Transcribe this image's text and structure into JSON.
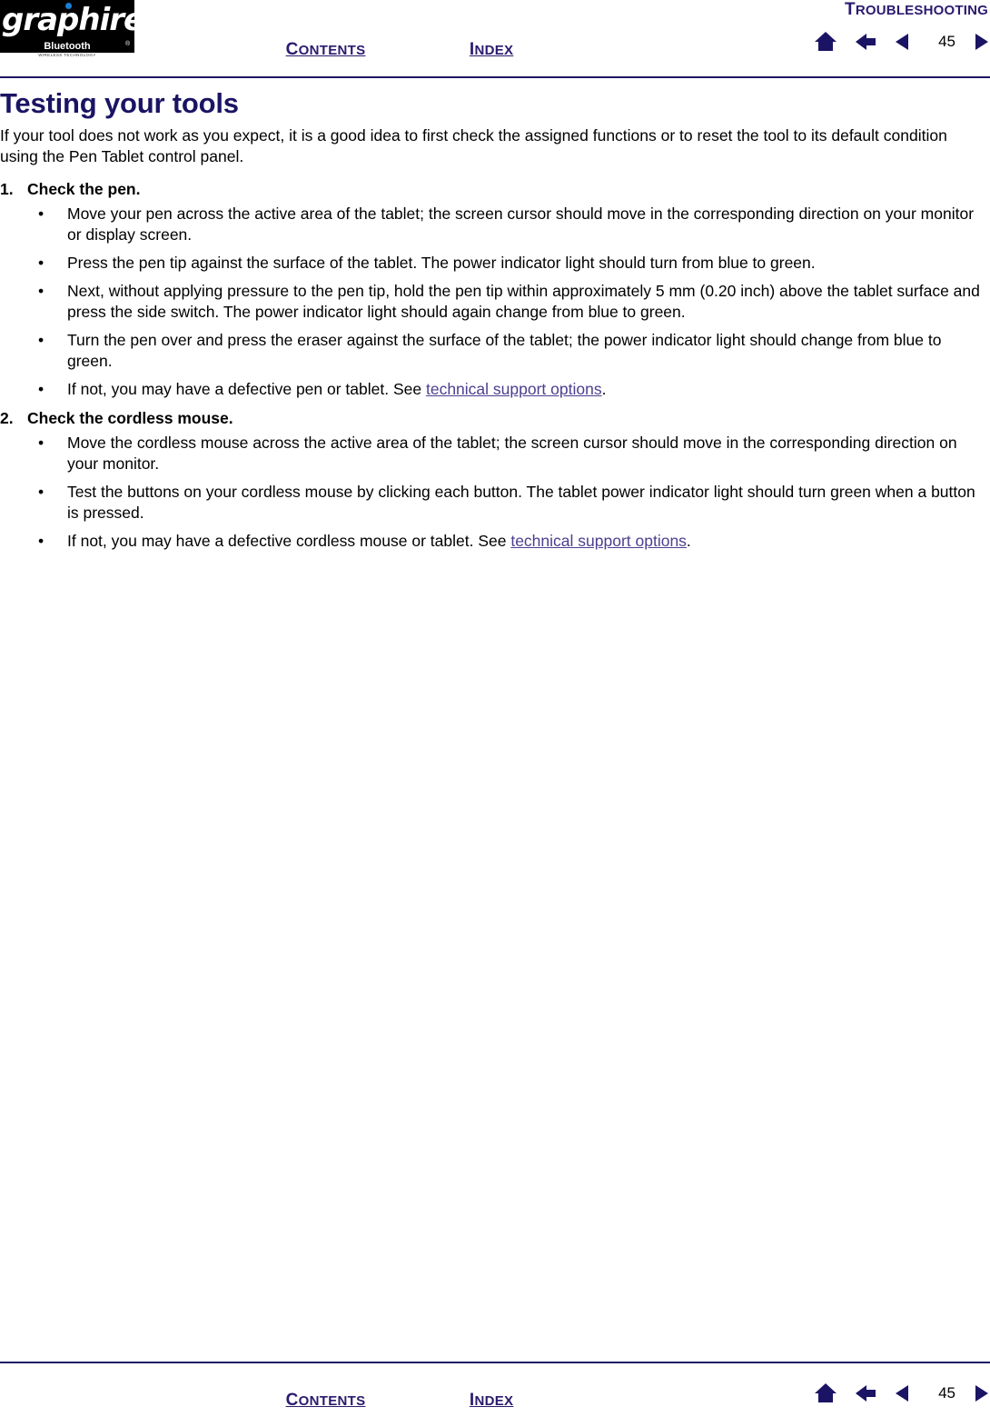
{
  "header": {
    "logo": {
      "wordmark": "graphire",
      "bluetooth": "Bluetooth",
      "trademark": "®",
      "tagline": "WIRELESS TECHNOLOGY"
    },
    "section_label": "TROUBLESHOOTING",
    "contents_link": "CONTENTS",
    "index_link": "INDEX",
    "page_number": "45"
  },
  "footer": {
    "contents_link": "CONTENTS",
    "index_link": "INDEX",
    "page_number": "45"
  },
  "main": {
    "title": "Testing your tools",
    "intro": "If your tool does not work as you expect, it is a good idea to first check the assigned functions or to reset the tool to its default condition using the Pen Tablet control panel.",
    "steps": [
      {
        "number": "1.",
        "heading": "Check the pen.",
        "bullets": [
          {
            "marker": "•",
            "text": "Move your pen across the active area of the tablet; the screen cursor should move in the corresponding direction on your monitor or display screen."
          },
          {
            "marker": "•",
            "text": "Press the pen tip against the surface of the tablet.  The power indicator light should turn from blue to green."
          },
          {
            "marker": "•",
            "text": "Next, without applying pressure to the pen tip, hold the pen tip within approximately 5 mm (0.20 inch) above the tablet surface and press the side switch.  The power indicator light should again change from blue to green."
          },
          {
            "marker": "•",
            "text": "Turn the pen over and press the eraser against the surface of the tablet; the power indicator light should change from blue to green."
          },
          {
            "marker": "•",
            "text_before": "If not, you may have a defective pen or tablet.    See ",
            "link": "technical support options",
            "text_after": "."
          }
        ]
      },
      {
        "number": "2.",
        "heading": "Check the cordless mouse.",
        "bullets": [
          {
            "marker": "•",
            "text": "Move the cordless mouse across the active area of the tablet; the screen cursor should move in the corresponding direction on your monitor."
          },
          {
            "marker": "•",
            "text": "Test the buttons on your cordless mouse by clicking each button.  The tablet power indicator light should turn green when a button is pressed."
          },
          {
            "marker": "•",
            "text_before": "If not, you may have a defective cordless mouse or tablet.  See ",
            "link": "technical support options",
            "text_after": "."
          }
        ]
      }
    ]
  },
  "colors": {
    "navy": "#1b1464",
    "link_purple": "#4b3f8f",
    "header_blue": "#2b1a6e"
  }
}
